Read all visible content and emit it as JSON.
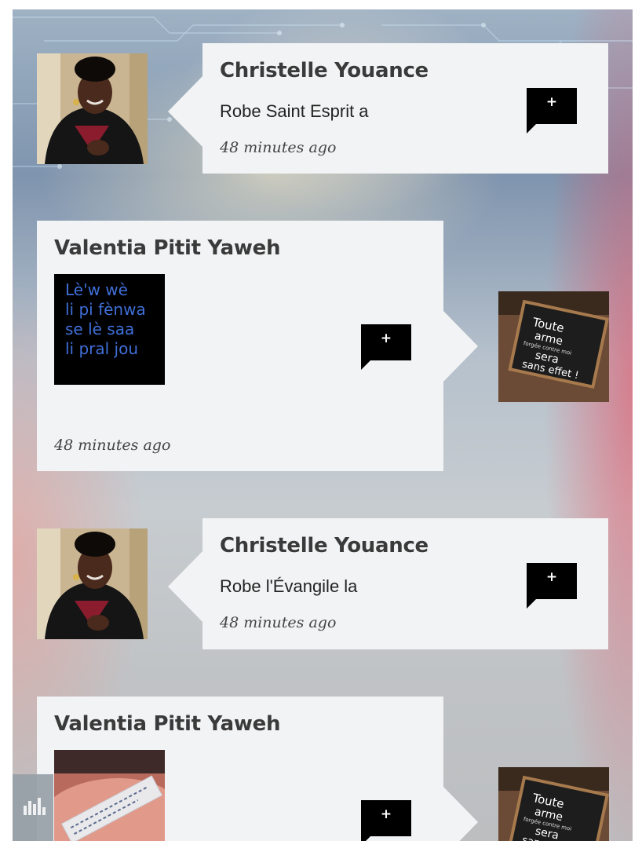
{
  "feed": {
    "posts": [
      {
        "author": "Christelle Youance",
        "message": "Robe Saint Esprit a",
        "time": "48 minutes ago",
        "comment_label": "+",
        "layout": "avatar-left"
      },
      {
        "author": "Valentia Pitit Yaweh",
        "image_text": [
          "Lè'w wè",
          "li pi fènwa",
          "se lè saa",
          "li pral jou"
        ],
        "time": "48 minutes ago",
        "comment_label": "+",
        "layout": "avatar-right",
        "thumb_text": [
          "Toute",
          "arme",
          "forgée contre moi",
          "sera",
          "sans effet !"
        ]
      },
      {
        "author": "Christelle Youance",
        "message": "Robe l'Évangile la",
        "time": "48 minutes ago",
        "comment_label": "+",
        "layout": "avatar-left"
      },
      {
        "author": "Valentia Pitit Yaweh",
        "comment_label": "+",
        "layout": "avatar-right",
        "image_note": "photo of hand holding fortune paper",
        "thumb_text": [
          "Toute",
          "arme",
          "forgée contre moi",
          "sera",
          "sans effet !"
        ]
      }
    ]
  },
  "colors": {
    "card_bg": "#f2f3f4",
    "comment_button_bg": "#000000",
    "name_text": "#3a3a3a",
    "text_image_fg": "#3f6fd8"
  },
  "icons": {
    "comment": "speech-bubble-plus-icon",
    "player": "equalizer-icon"
  }
}
